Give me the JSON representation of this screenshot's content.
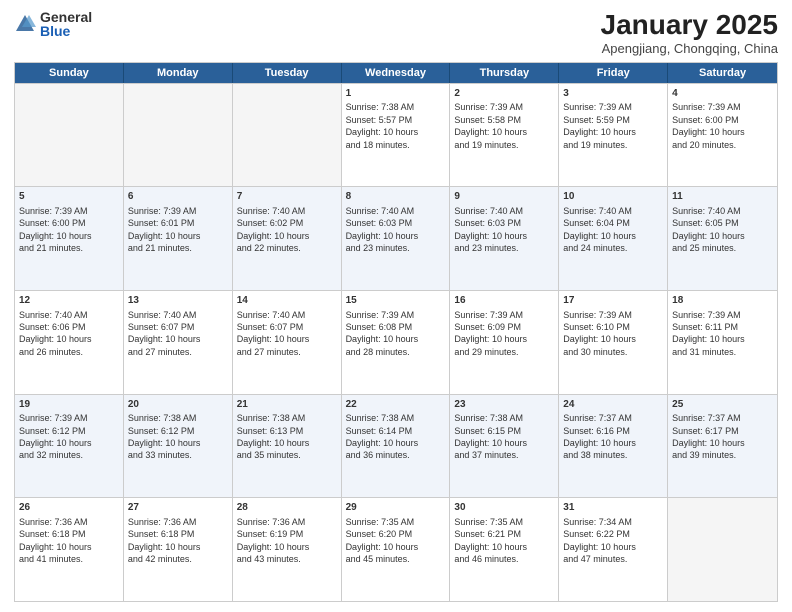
{
  "logo": {
    "general": "General",
    "blue": "Blue"
  },
  "title": "January 2025",
  "subtitle": "Apengjiang, Chongqing, China",
  "headers": [
    "Sunday",
    "Monday",
    "Tuesday",
    "Wednesday",
    "Thursday",
    "Friday",
    "Saturday"
  ],
  "rows": [
    [
      {
        "day": "",
        "text": ""
      },
      {
        "day": "",
        "text": ""
      },
      {
        "day": "",
        "text": ""
      },
      {
        "day": "1",
        "text": "Sunrise: 7:38 AM\nSunset: 5:57 PM\nDaylight: 10 hours\nand 18 minutes."
      },
      {
        "day": "2",
        "text": "Sunrise: 7:39 AM\nSunset: 5:58 PM\nDaylight: 10 hours\nand 19 minutes."
      },
      {
        "day": "3",
        "text": "Sunrise: 7:39 AM\nSunset: 5:59 PM\nDaylight: 10 hours\nand 19 minutes."
      },
      {
        "day": "4",
        "text": "Sunrise: 7:39 AM\nSunset: 6:00 PM\nDaylight: 10 hours\nand 20 minutes."
      }
    ],
    [
      {
        "day": "5",
        "text": "Sunrise: 7:39 AM\nSunset: 6:00 PM\nDaylight: 10 hours\nand 21 minutes."
      },
      {
        "day": "6",
        "text": "Sunrise: 7:39 AM\nSunset: 6:01 PM\nDaylight: 10 hours\nand 21 minutes."
      },
      {
        "day": "7",
        "text": "Sunrise: 7:40 AM\nSunset: 6:02 PM\nDaylight: 10 hours\nand 22 minutes."
      },
      {
        "day": "8",
        "text": "Sunrise: 7:40 AM\nSunset: 6:03 PM\nDaylight: 10 hours\nand 23 minutes."
      },
      {
        "day": "9",
        "text": "Sunrise: 7:40 AM\nSunset: 6:03 PM\nDaylight: 10 hours\nand 23 minutes."
      },
      {
        "day": "10",
        "text": "Sunrise: 7:40 AM\nSunset: 6:04 PM\nDaylight: 10 hours\nand 24 minutes."
      },
      {
        "day": "11",
        "text": "Sunrise: 7:40 AM\nSunset: 6:05 PM\nDaylight: 10 hours\nand 25 minutes."
      }
    ],
    [
      {
        "day": "12",
        "text": "Sunrise: 7:40 AM\nSunset: 6:06 PM\nDaylight: 10 hours\nand 26 minutes."
      },
      {
        "day": "13",
        "text": "Sunrise: 7:40 AM\nSunset: 6:07 PM\nDaylight: 10 hours\nand 27 minutes."
      },
      {
        "day": "14",
        "text": "Sunrise: 7:40 AM\nSunset: 6:07 PM\nDaylight: 10 hours\nand 27 minutes."
      },
      {
        "day": "15",
        "text": "Sunrise: 7:39 AM\nSunset: 6:08 PM\nDaylight: 10 hours\nand 28 minutes."
      },
      {
        "day": "16",
        "text": "Sunrise: 7:39 AM\nSunset: 6:09 PM\nDaylight: 10 hours\nand 29 minutes."
      },
      {
        "day": "17",
        "text": "Sunrise: 7:39 AM\nSunset: 6:10 PM\nDaylight: 10 hours\nand 30 minutes."
      },
      {
        "day": "18",
        "text": "Sunrise: 7:39 AM\nSunset: 6:11 PM\nDaylight: 10 hours\nand 31 minutes."
      }
    ],
    [
      {
        "day": "19",
        "text": "Sunrise: 7:39 AM\nSunset: 6:12 PM\nDaylight: 10 hours\nand 32 minutes."
      },
      {
        "day": "20",
        "text": "Sunrise: 7:38 AM\nSunset: 6:12 PM\nDaylight: 10 hours\nand 33 minutes."
      },
      {
        "day": "21",
        "text": "Sunrise: 7:38 AM\nSunset: 6:13 PM\nDaylight: 10 hours\nand 35 minutes."
      },
      {
        "day": "22",
        "text": "Sunrise: 7:38 AM\nSunset: 6:14 PM\nDaylight: 10 hours\nand 36 minutes."
      },
      {
        "day": "23",
        "text": "Sunrise: 7:38 AM\nSunset: 6:15 PM\nDaylight: 10 hours\nand 37 minutes."
      },
      {
        "day": "24",
        "text": "Sunrise: 7:37 AM\nSunset: 6:16 PM\nDaylight: 10 hours\nand 38 minutes."
      },
      {
        "day": "25",
        "text": "Sunrise: 7:37 AM\nSunset: 6:17 PM\nDaylight: 10 hours\nand 39 minutes."
      }
    ],
    [
      {
        "day": "26",
        "text": "Sunrise: 7:36 AM\nSunset: 6:18 PM\nDaylight: 10 hours\nand 41 minutes."
      },
      {
        "day": "27",
        "text": "Sunrise: 7:36 AM\nSunset: 6:18 PM\nDaylight: 10 hours\nand 42 minutes."
      },
      {
        "day": "28",
        "text": "Sunrise: 7:36 AM\nSunset: 6:19 PM\nDaylight: 10 hours\nand 43 minutes."
      },
      {
        "day": "29",
        "text": "Sunrise: 7:35 AM\nSunset: 6:20 PM\nDaylight: 10 hours\nand 45 minutes."
      },
      {
        "day": "30",
        "text": "Sunrise: 7:35 AM\nSunset: 6:21 PM\nDaylight: 10 hours\nand 46 minutes."
      },
      {
        "day": "31",
        "text": "Sunrise: 7:34 AM\nSunset: 6:22 PM\nDaylight: 10 hours\nand 47 minutes."
      },
      {
        "day": "",
        "text": ""
      }
    ]
  ]
}
